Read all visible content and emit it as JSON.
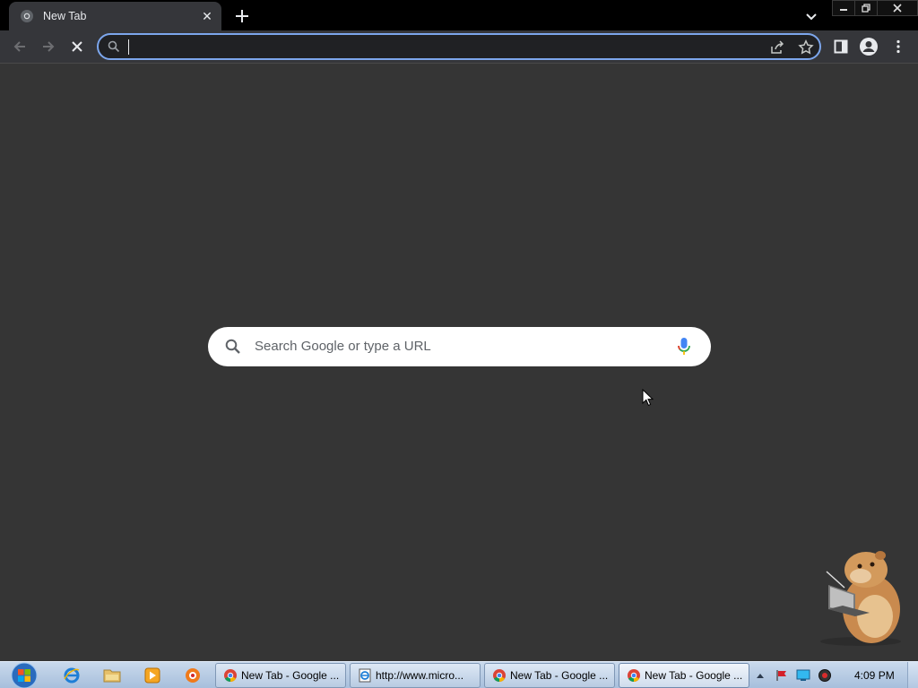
{
  "browser": {
    "tab": {
      "title": "New Tab",
      "close_icon": "close-icon"
    },
    "new_tab_icon": "plus-icon",
    "omnibox": {
      "value": "",
      "placeholder": ""
    }
  },
  "ntp": {
    "search_placeholder": "Search Google or type a URL"
  },
  "taskbar": {
    "tasks": [
      {
        "label": "New Tab - Google ...",
        "icon": "chrome-icon"
      },
      {
        "label": "http://www.micro...",
        "icon": "ie-document-icon"
      },
      {
        "label": "New Tab - Google ...",
        "icon": "chrome-icon"
      },
      {
        "label": "New Tab - Google ...",
        "icon": "chrome-icon"
      }
    ],
    "clock": "4:09 PM"
  },
  "colors": {
    "page_bg": "#353535",
    "tabstrip_bg": "#000000",
    "toolbar_bg": "#35363a",
    "omnibox_focus": "#7ca6ec",
    "mic_blue": "#4285f4"
  }
}
